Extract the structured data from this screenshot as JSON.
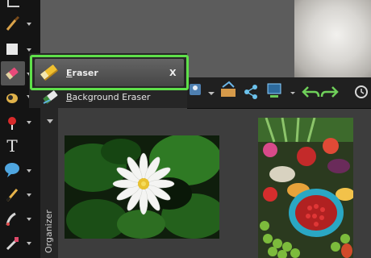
{
  "flyout_menu": {
    "items": [
      {
        "label": "Eraser",
        "shortcut": "X",
        "icon": "eraser-icon",
        "selected": true
      },
      {
        "label": "Background Eraser",
        "icon": "background-eraser-icon",
        "selected": false
      }
    ],
    "highlight_color": "#5fe04a"
  },
  "side_panel": {
    "label": "Organizer"
  },
  "toolbar": {
    "tools": [
      "crop-icon",
      "brush-icon",
      "shape-icon",
      "eraser-icon",
      "paint-bucket-icon",
      "red-eye-icon",
      "text-icon",
      "speech-bubble-icon",
      "pen-icon",
      "smudge-icon",
      "retouch-icon"
    ]
  },
  "options_bar": {
    "icons": [
      "dropdown-icon",
      "enhance-icon",
      "share-icon",
      "export-icon",
      "undo-icon",
      "redo-icon",
      "history-icon"
    ]
  },
  "photos": [
    "lotus-flower-photo",
    "vegetable-market-photo"
  ]
}
